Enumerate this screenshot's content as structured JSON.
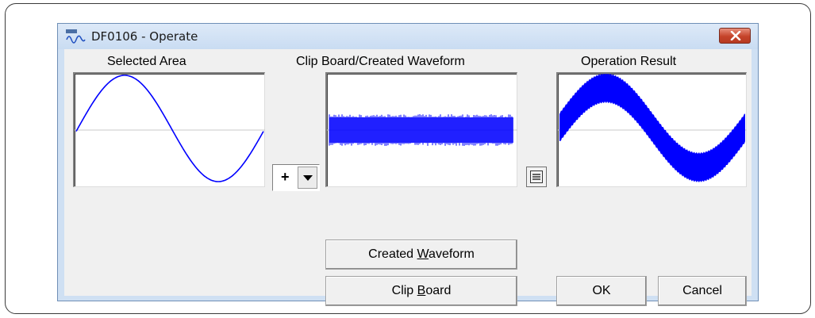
{
  "window": {
    "title": "DF0106 - Operate",
    "app_icon": "waveform-app-icon",
    "close_icon": "close-icon"
  },
  "labels": {
    "selected_area": "Selected Area",
    "clip_board_created": "Clip Board/Created Waveform",
    "operation_result": "Operation Result"
  },
  "operator": {
    "value": "+",
    "dropdown_icon": "chevron-down-icon"
  },
  "equals_button_icon": "equals-icon",
  "buttons": {
    "created_waveform": {
      "pre": "Created ",
      "accel": "W",
      "post": "aveform"
    },
    "clip_board": {
      "pre": "Clip ",
      "accel": "B",
      "post": "oard"
    },
    "ok": "OK",
    "cancel": "Cancel"
  },
  "colors": {
    "waveform": "#0000ff",
    "close_button": "#c5432a",
    "window_frame": "#cfe0f3"
  }
}
